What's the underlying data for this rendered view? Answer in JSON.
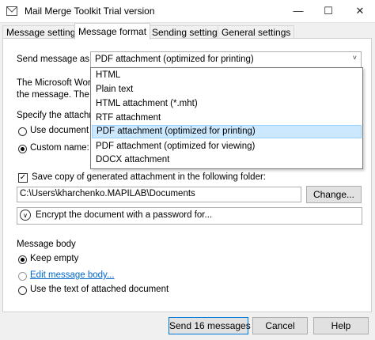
{
  "window": {
    "title": "Mail Merge Toolkit Trial version",
    "minimize_glyph": "—",
    "maximize_glyph": "☐",
    "close_glyph": "✕"
  },
  "tabs": [
    {
      "label": "Message settings",
      "active": false
    },
    {
      "label": "Message format",
      "active": true
    },
    {
      "label": "Sending settings",
      "active": false
    },
    {
      "label": "General settings",
      "active": false
    }
  ],
  "send_as": {
    "label": "Send message as:",
    "selected": "PDF attachment (optimized for printing)",
    "arrow": "˅",
    "options": [
      "HTML",
      "Plain text",
      "HTML attachment (*.mht)",
      "RTF attachment",
      "PDF attachment (optimized for printing)",
      "PDF attachment (optimized for viewing)",
      "DOCX attachment"
    ],
    "selected_index": 4
  },
  "description": {
    "line1": "The Microsoft Word",
    "line2": "the message. The PDF"
  },
  "attachment_name": {
    "heading": "Specify the attachme",
    "option_doc": "Use document n",
    "option_custom": "Custom name:"
  },
  "save_copy": {
    "label": "Save copy of generated attachment in the following folder:",
    "checked": true,
    "check_glyph": "✓",
    "path": "C:\\Users\\kharchenko.MAPILAB\\Documents",
    "change_label": "Change..."
  },
  "encrypt": {
    "label": "Encrypt the document with a password for...",
    "icon_glyph": "∨"
  },
  "message_body": {
    "heading": "Message body",
    "keep_empty": "Keep empty",
    "edit_body": "Edit message body...",
    "use_attached": "Use the text of attached document"
  },
  "footer": {
    "send_label": "Send 16 messages",
    "cancel_label": "Cancel",
    "help_label": "Help"
  },
  "colors": {
    "accent": "#0078d7",
    "selection": "#cce8ff",
    "link": "#0066cc"
  }
}
